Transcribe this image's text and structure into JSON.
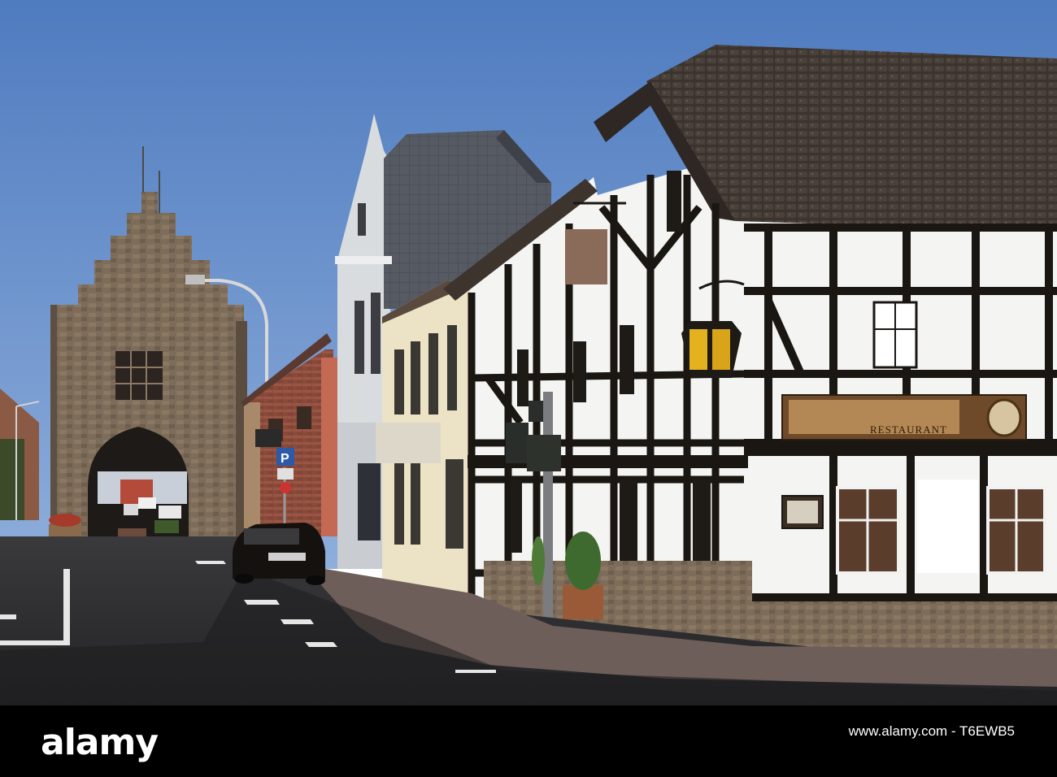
{
  "footer": {
    "brand": "alamy",
    "image_id": "www.alamy.com - T6EWB5"
  },
  "scene": {
    "restaurant_sign": "RESTAURANT",
    "parking_sign": "P"
  },
  "colors": {
    "sky": "#5f86c4",
    "timber": "#1a1612",
    "plaster": "#f4f4f2",
    "roof": "#3a322d",
    "stone": "#7a6a58",
    "road": "#2c2c2e"
  }
}
